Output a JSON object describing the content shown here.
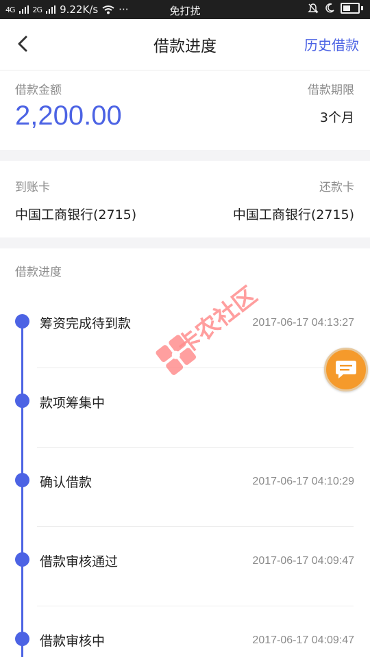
{
  "status_bar": {
    "signal1": "4G",
    "signal2": "2G",
    "speed": "9.22K/s",
    "dots": "···",
    "mode": "免打扰"
  },
  "nav": {
    "title": "借款进度",
    "history_label": "历史借款",
    "back_icon": "chevron-left-icon"
  },
  "loan": {
    "amount_label": "借款金额",
    "amount": "2,200.00",
    "term_label": "借款期限",
    "term": "3个月"
  },
  "cards": {
    "receive_label": "到账卡",
    "receive_value": "中国工商银行(2715)",
    "repay_label": "还款卡",
    "repay_value": "中国工商银行(2715)"
  },
  "progress": {
    "section_label": "借款进度",
    "steps": [
      {
        "name": "筹资完成待到款",
        "time": "2017-06-17 04:13:27"
      },
      {
        "name": "款项筹集中",
        "time": ""
      },
      {
        "name": "确认借款",
        "time": "2017-06-17 04:10:29"
      },
      {
        "name": "借款审核通过",
        "time": "2017-06-17 04:09:47"
      },
      {
        "name": "借款审核中",
        "time": "2017-06-17 04:09:47"
      }
    ]
  },
  "watermark": {
    "text": "卡农社区"
  },
  "colors": {
    "accent": "#4c63e4",
    "fab": "#f59a2b"
  }
}
